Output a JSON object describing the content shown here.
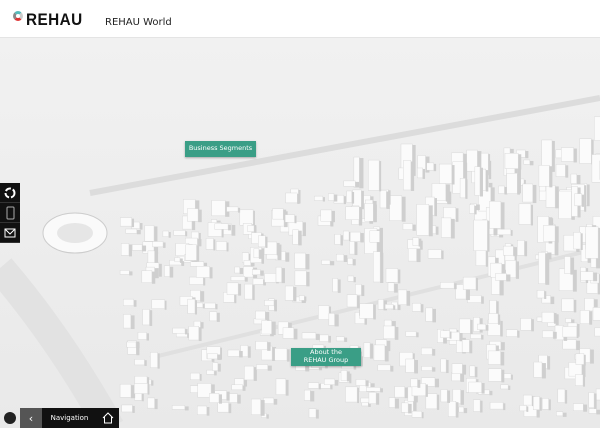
{
  "header": {
    "logo_text": "REHAU",
    "title": "REHAU World"
  },
  "hotspots": {
    "business_segments": "Business Segments",
    "about_group": "About the REHAU Group"
  },
  "sidebar": {
    "icons": [
      "rehau-circle-icon",
      "mobile-phone-icon",
      "mail-icon"
    ]
  },
  "bottom_nav": {
    "back_icon": "chevron-left-icon",
    "label": "Navigation",
    "home_icon": "home-icon",
    "cookie_icon": "cookie-icon"
  },
  "colors": {
    "accent": "#3a9e86",
    "bar": "#111111"
  }
}
